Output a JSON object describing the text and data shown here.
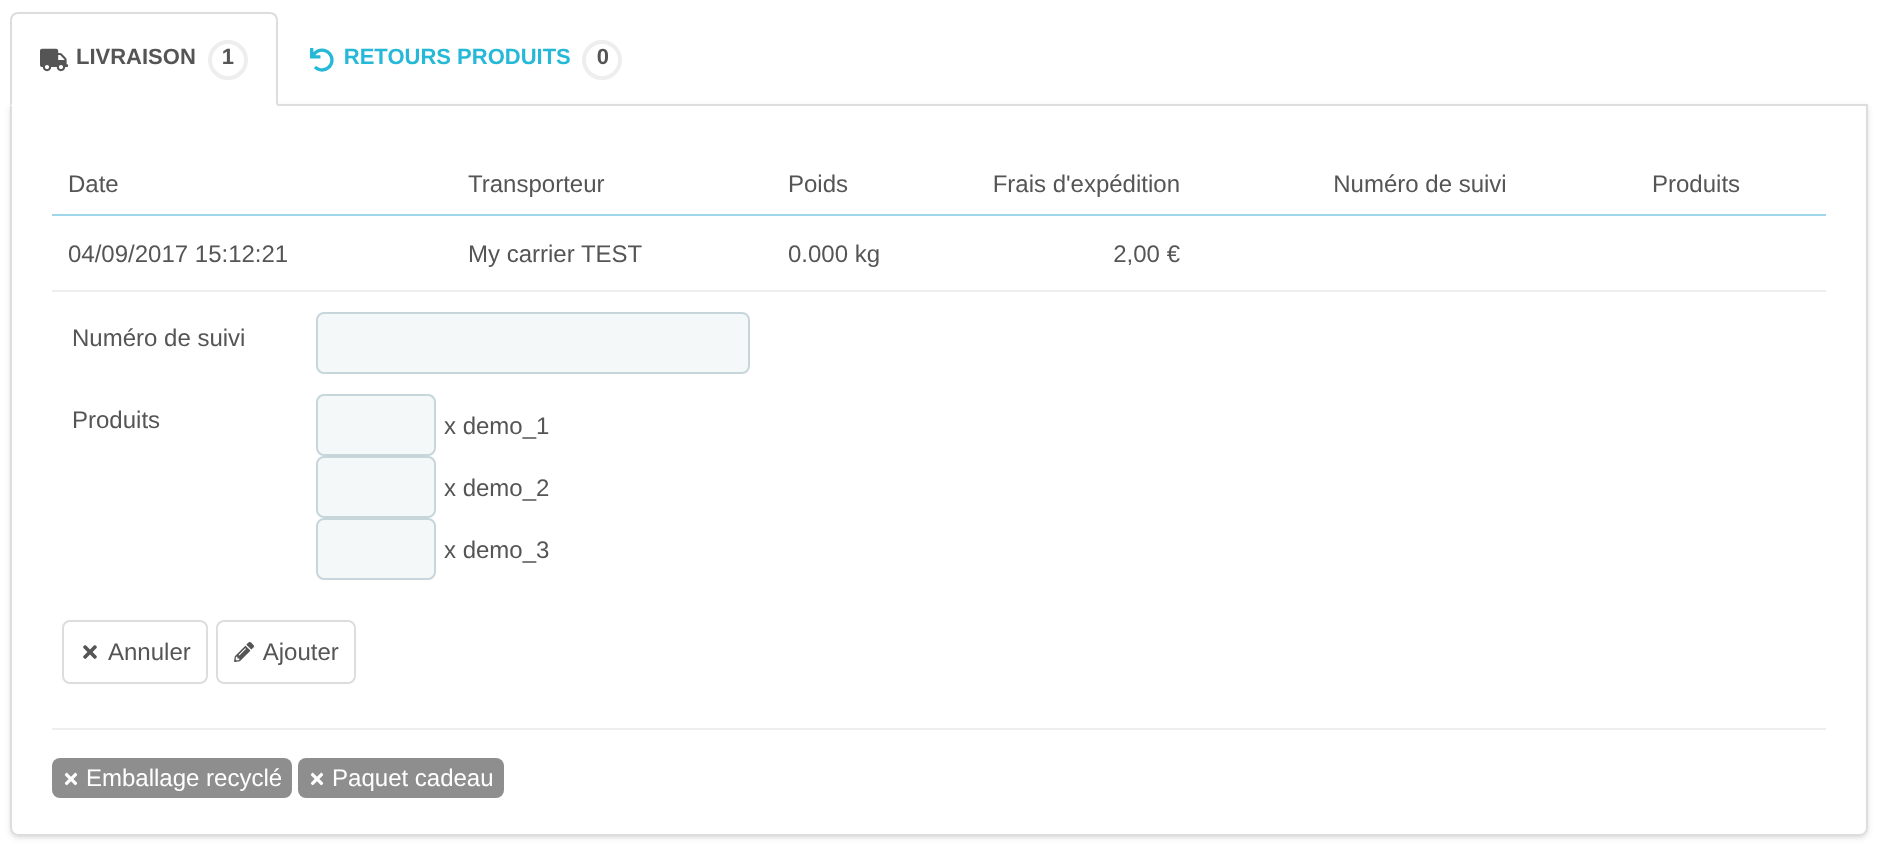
{
  "tabs": [
    {
      "kind": "truck",
      "label": "LIVRAISON",
      "count": "1",
      "selected": true
    },
    {
      "kind": "undo",
      "label": "RETOURS PRODUITS",
      "count": "0",
      "selected": false
    }
  ],
  "table": {
    "columns": [
      "Date",
      "Transporteur",
      "Poids",
      "Frais d'expédition",
      "Numéro de suivi",
      "Produits"
    ],
    "rows": [
      [
        "04/09/2017 15:12:21",
        "My carrier TEST",
        "0.000 kg",
        "2,00 €",
        "",
        ""
      ]
    ]
  },
  "form": {
    "tracking_label": "Numéro de suivi",
    "products_label": "Produits",
    "products": [
      "x demo_1",
      "x demo_2",
      "x demo_3"
    ]
  },
  "buttons": [
    {
      "kind": "cancel",
      "label": "Annuler"
    },
    {
      "kind": "add",
      "label": "Ajouter"
    }
  ],
  "options": [
    "Emballage recyclé",
    "Paquet cadeau"
  ]
}
